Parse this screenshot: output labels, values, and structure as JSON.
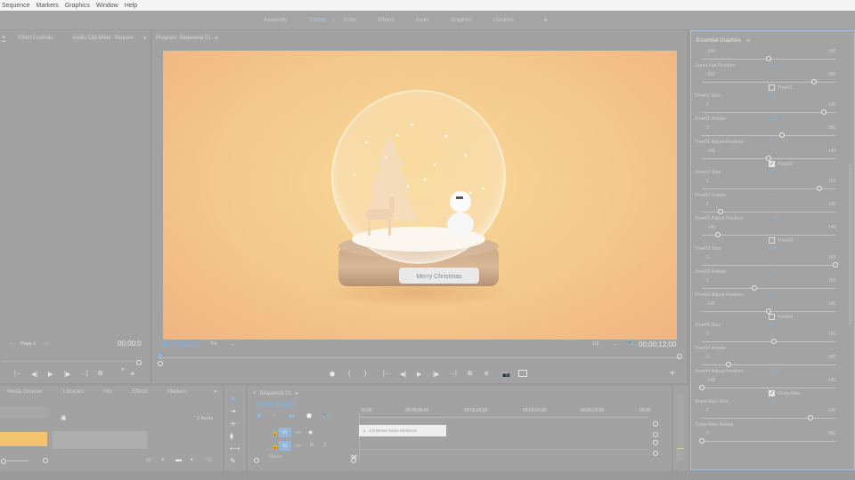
{
  "menubar": [
    "Sequence",
    "Markers",
    "Graphics",
    "Window",
    "Help"
  ],
  "workspaces": {
    "tabs": [
      "Assembly",
      "Editing",
      "Color",
      "Effects",
      "Audio",
      "Graphics",
      "Libraries"
    ],
    "active": "Editing",
    "overflow_icon": "»"
  },
  "left_panel": {
    "tabs": [
      "Effect Controls",
      "Audio Clip Mixer: Sequen"
    ],
    "overflow_icon": "»",
    "page_label": "Page 1",
    "timecode": "00;00;0"
  },
  "program_monitor": {
    "title": "Program: Sequence 01",
    "video": {
      "label_text": "Merry Christmas",
      "description": "snow globe with tree, reindeer and snowman"
    },
    "timecode_current": "00;00;00;00",
    "fit": "Fit",
    "resolution": "1/2",
    "timecode_duration": "00;00;12;00"
  },
  "essential_graphics": {
    "title": "Essential Graphics",
    "rows": [
      {
        "type": "slider",
        "min": "-300",
        "max": "300",
        "fraction": 0.5
      },
      {
        "type": "label",
        "label": "Santa Hat Position",
        "value": "110"
      },
      {
        "type": "slider",
        "min": "-300",
        "max": "300",
        "fraction": 0.84
      },
      {
        "type": "check",
        "label": "Tree01",
        "checked": false
      },
      {
        "type": "label",
        "label": "Tree01 Size",
        "value": "91"
      },
      {
        "type": "slider",
        "min": "0",
        "max": "100",
        "fraction": 0.91
      },
      {
        "type": "label",
        "label": "Tree01 Rotate",
        "value": "215"
      },
      {
        "type": "slider",
        "min": "0",
        "max": "360",
        "fraction": 0.6
      },
      {
        "type": "label",
        "label": "Tree01 Adjust Position",
        "value": "0"
      },
      {
        "type": "slider",
        "min": "-145",
        "max": "145",
        "fraction": 0.5
      },
      {
        "type": "check",
        "label": "Tree02",
        "checked": true
      },
      {
        "type": "label",
        "label": "Tree02 Size",
        "value": "91"
      },
      {
        "type": "slider",
        "min": "0",
        "max": "100",
        "fraction": 0.88
      },
      {
        "type": "label",
        "label": "Tree02 Rotate",
        "value": "14"
      },
      {
        "type": "slider",
        "min": "0",
        "max": "100",
        "fraction": 0.14
      },
      {
        "type": "label",
        "label": "Tree02 Adjust Position",
        "value": "-103"
      },
      {
        "type": "slider",
        "min": "-145",
        "max": "145",
        "fraction": 0.12
      },
      {
        "type": "check",
        "label": "Tree03",
        "checked": false
      },
      {
        "type": "label",
        "label": "Tree03 Size",
        "value": "100"
      },
      {
        "type": "slider",
        "min": "0",
        "max": "100",
        "fraction": 1.0
      },
      {
        "type": "label",
        "label": "Tree03 Rotate",
        "value": "39"
      },
      {
        "type": "slider",
        "min": "0",
        "max": "100",
        "fraction": 0.39
      },
      {
        "type": "label",
        "label": "Tree03 Adjust Position",
        "value": "0"
      },
      {
        "type": "slider",
        "min": "-145",
        "max": "145",
        "fraction": 0.5
      },
      {
        "type": "check",
        "label": "Tree04",
        "checked": false
      },
      {
        "type": "label",
        "label": "Tree04 Size",
        "value": "54"
      },
      {
        "type": "slider",
        "min": "0",
        "max": "100",
        "fraction": 0.54
      },
      {
        "type": "label",
        "label": "Tree04 Rotate",
        "value": "70"
      },
      {
        "type": "slider",
        "min": "0",
        "max": "360",
        "fraction": 0.2
      },
      {
        "type": "label",
        "label": "Tree04 Adjust Position",
        "value": "-145"
      },
      {
        "type": "slider",
        "min": "-145",
        "max": "145",
        "fraction": 0.0
      },
      {
        "type": "check",
        "label": "Snow Man",
        "checked": true
      },
      {
        "type": "label",
        "label": "Snow Man Size",
        "value": "81"
      },
      {
        "type": "slider",
        "min": "0",
        "max": "100",
        "fraction": 0.81
      },
      {
        "type": "label",
        "label": "Snow Man Rotate",
        "value": "1"
      },
      {
        "type": "slider",
        "min": "0",
        "max": "360",
        "fraction": 0.0
      }
    ]
  },
  "media_panel": {
    "tabs": [
      "Media Browser",
      "Libraries",
      "Info",
      "Effects",
      "Markers"
    ],
    "overflow_icon": "»",
    "item_count": "2 Items"
  },
  "timeline": {
    "title": "Sequence 01",
    "timecode": "00;00;00;00",
    "ruler": [
      "00;00",
      "00;00;08;00",
      "00;00;16;00",
      "00;00;24;00",
      "00;00;32;00",
      "00;00"
    ],
    "tracks": [
      "V1",
      "A1"
    ],
    "clip_label": "Christmas Globe Elements",
    "master_label": "Master"
  }
}
